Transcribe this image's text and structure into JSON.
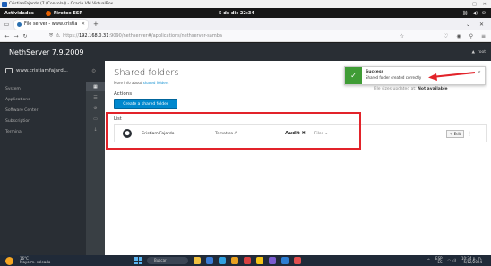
{
  "vbox": {
    "title": "CristianFajardo (7 (Consola)) - Oracle VM VirtualBox",
    "controls": [
      "–",
      "□",
      "✕"
    ]
  },
  "gnome": {
    "activities": "Actividades",
    "app_name": "Firefox ESR",
    "clock": "5 de dic 22:34"
  },
  "browser": {
    "tab_title": "File server - www.cristia",
    "url_host": "192.168.0.31",
    "url_prefix": "https://",
    "url_rest": ":9090/nethserver#/applications/nethserver-samba"
  },
  "nethserver": {
    "brand": "NethServer 7.9.2009",
    "user_label": "root",
    "hostname": "www.cristiamfajard...",
    "nav": [
      "System",
      "Applications",
      "Software Center",
      "Subscription",
      "Terminal"
    ]
  },
  "main": {
    "title": "Shared folders",
    "info_prefix": "More info about",
    "info_link": "shared folders",
    "status_prefix": "File sizes updated at:",
    "status_value": "Not available",
    "actions_heading": "Actions",
    "create_button": "Create a shared folder",
    "list_heading": "List",
    "rows": [
      {
        "owner": "Cristiam Fajardo",
        "group": "Tematica A",
        "audit": "Audit ✖",
        "files": "- Files ⌄",
        "edit": "✎ Edit",
        "menu": "⋮"
      }
    ]
  },
  "toast": {
    "title": "Success",
    "message": "Shared folder created correctly",
    "close": "×"
  },
  "taskbar": {
    "temperature": "16°C",
    "weather": "Mayorm. soleado",
    "search": "Buscar",
    "lang1": "ESP",
    "lang2": "ES",
    "time": "10:34 p. m.",
    "date": "5/12/2024"
  },
  "colors": {
    "accent": "#0088ce",
    "success": "#3f9c35",
    "highlight": "#e2232a",
    "nav_bg": "#292e34"
  }
}
